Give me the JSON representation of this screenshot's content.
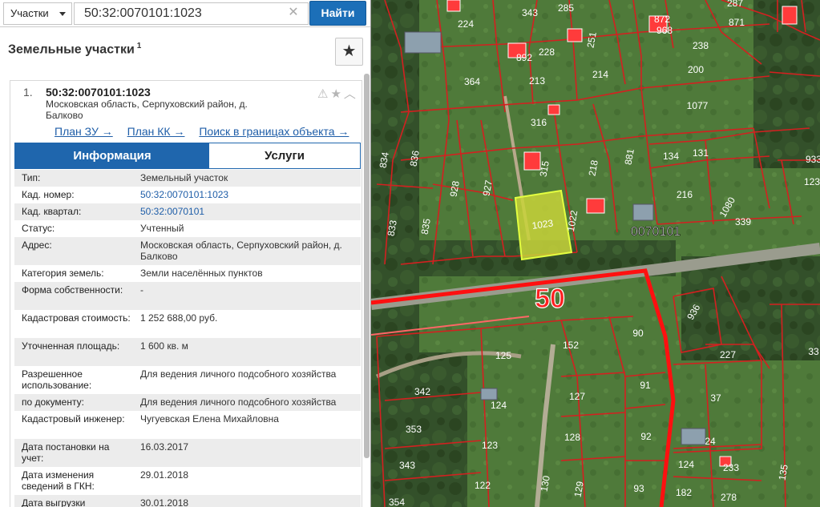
{
  "search": {
    "type_label": "Участки",
    "query": "50:32:0070101:1023",
    "find_label": "Найти"
  },
  "header": {
    "title": "Земельные участки",
    "count": "1"
  },
  "result": {
    "number": "1.",
    "cadastral_number": "50:32:0070101:1023",
    "address": "Московская область, Серпуховский район, д. Балково",
    "links": [
      "План ЗУ →",
      "План КК →",
      "Поиск в границах объекта →"
    ]
  },
  "tabs": {
    "info": "Информация",
    "services": "Услуги"
  },
  "info_rows": [
    {
      "label": "Тип:",
      "value": "Земельный участок"
    },
    {
      "label": "Кад. номер:",
      "value": "50:32:0070101:1023"
    },
    {
      "label": "Кад. квартал:",
      "value": "50:32:0070101"
    },
    {
      "label": "Статус:",
      "value": "Учтенный"
    },
    {
      "label": "Адрес:",
      "value": "Московская область, Серпуховский район, д. Балково"
    },
    {
      "label": "Категория земель:",
      "value": "Земли населённых пунктов"
    },
    {
      "label": "Форма собственности:",
      "value": "-"
    },
    {
      "label": "Кадастровая стоимость:",
      "value": "1 252 688,00 руб."
    },
    {
      "label": "Уточненная площадь:",
      "value": "1 600 кв. м"
    },
    {
      "label": "Разрешенное использование:",
      "value": "Для ведения личного подсобного хозяйства"
    },
    {
      "label": "по документу:",
      "value": "Для ведения личного подсобного хозяйства"
    },
    {
      "label": "Кадастровый инженер:",
      "value": "Чугуевская Елена Михайловна"
    },
    {
      "label": "Дата постановки на учет:",
      "value": "16.03.2017"
    },
    {
      "label": "Дата изменения сведений в ГКН:",
      "value": "29.01.2018"
    },
    {
      "label": "Дата выгрузки",
      "value": "30.01.2018"
    }
  ],
  "map": {
    "quarter_label": "0070101",
    "district_label": "50",
    "selected_plot": "1023",
    "plot_labels": [
      "343",
      "285",
      "287",
      "224",
      "872",
      "968",
      "871",
      "251",
      "892",
      "228",
      "238",
      "364",
      "213",
      "214",
      "200",
      "1077",
      "316",
      "834",
      "836",
      "315",
      "218",
      "881",
      "134",
      "131",
      "928",
      "927",
      "216",
      "1080",
      "123",
      "833",
      "835",
      "1023",
      "1022",
      "339",
      "936",
      "90",
      "125",
      "152",
      "227",
      "342",
      "91",
      "127",
      "37",
      "124",
      "353",
      "128",
      "92",
      "24",
      "123",
      "343",
      "124",
      "233",
      "122",
      "130",
      "129",
      "93",
      "182",
      "278",
      "354",
      "135",
      "33",
      "933"
    ],
    "colors": {
      "parcel_border": "#d42020",
      "selected_fill": "#c8d43a",
      "building": "#ff3b3b",
      "district_border": "#ff1010"
    }
  }
}
